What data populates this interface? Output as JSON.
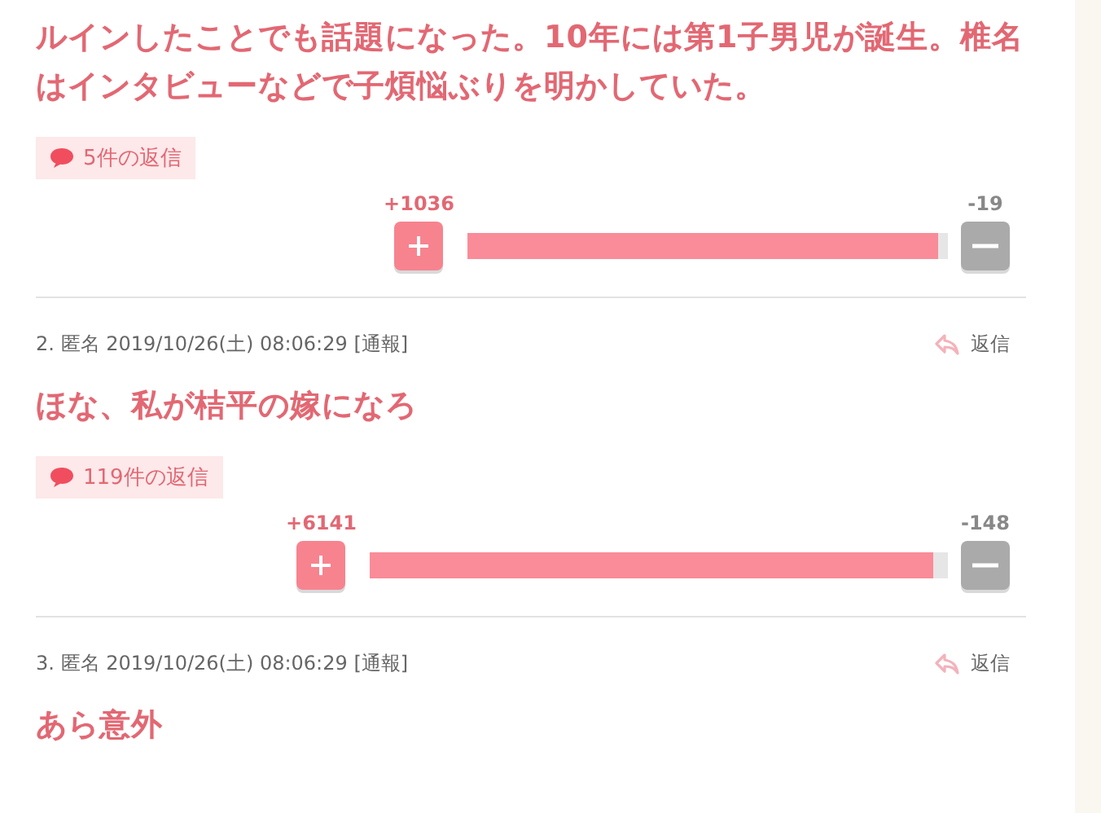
{
  "comments": [
    {
      "body": "ルインしたことでも話題になった。10年には第1子男児が誕生。椎名はインタビューなどで子煩悩ぶりを明かしていた。",
      "replies": "5件の返信",
      "plus": "+1036",
      "minus": "-19",
      "level": 0.98
    },
    {
      "number": "2.",
      "author": "匿名",
      "date": "2019/10/26(土) 08:06:29",
      "report": "[通報]",
      "reply": "返信",
      "body": "ほな、私が桔平の嫁になろ",
      "replies": "119件の返信",
      "plus": "+6141",
      "minus": "-148",
      "level": 0.976
    },
    {
      "number": "3.",
      "author": "匿名",
      "date": "2019/10/26(土) 08:06:29",
      "report": "[通報]",
      "reply": "返信",
      "body": "あら意外"
    }
  ]
}
